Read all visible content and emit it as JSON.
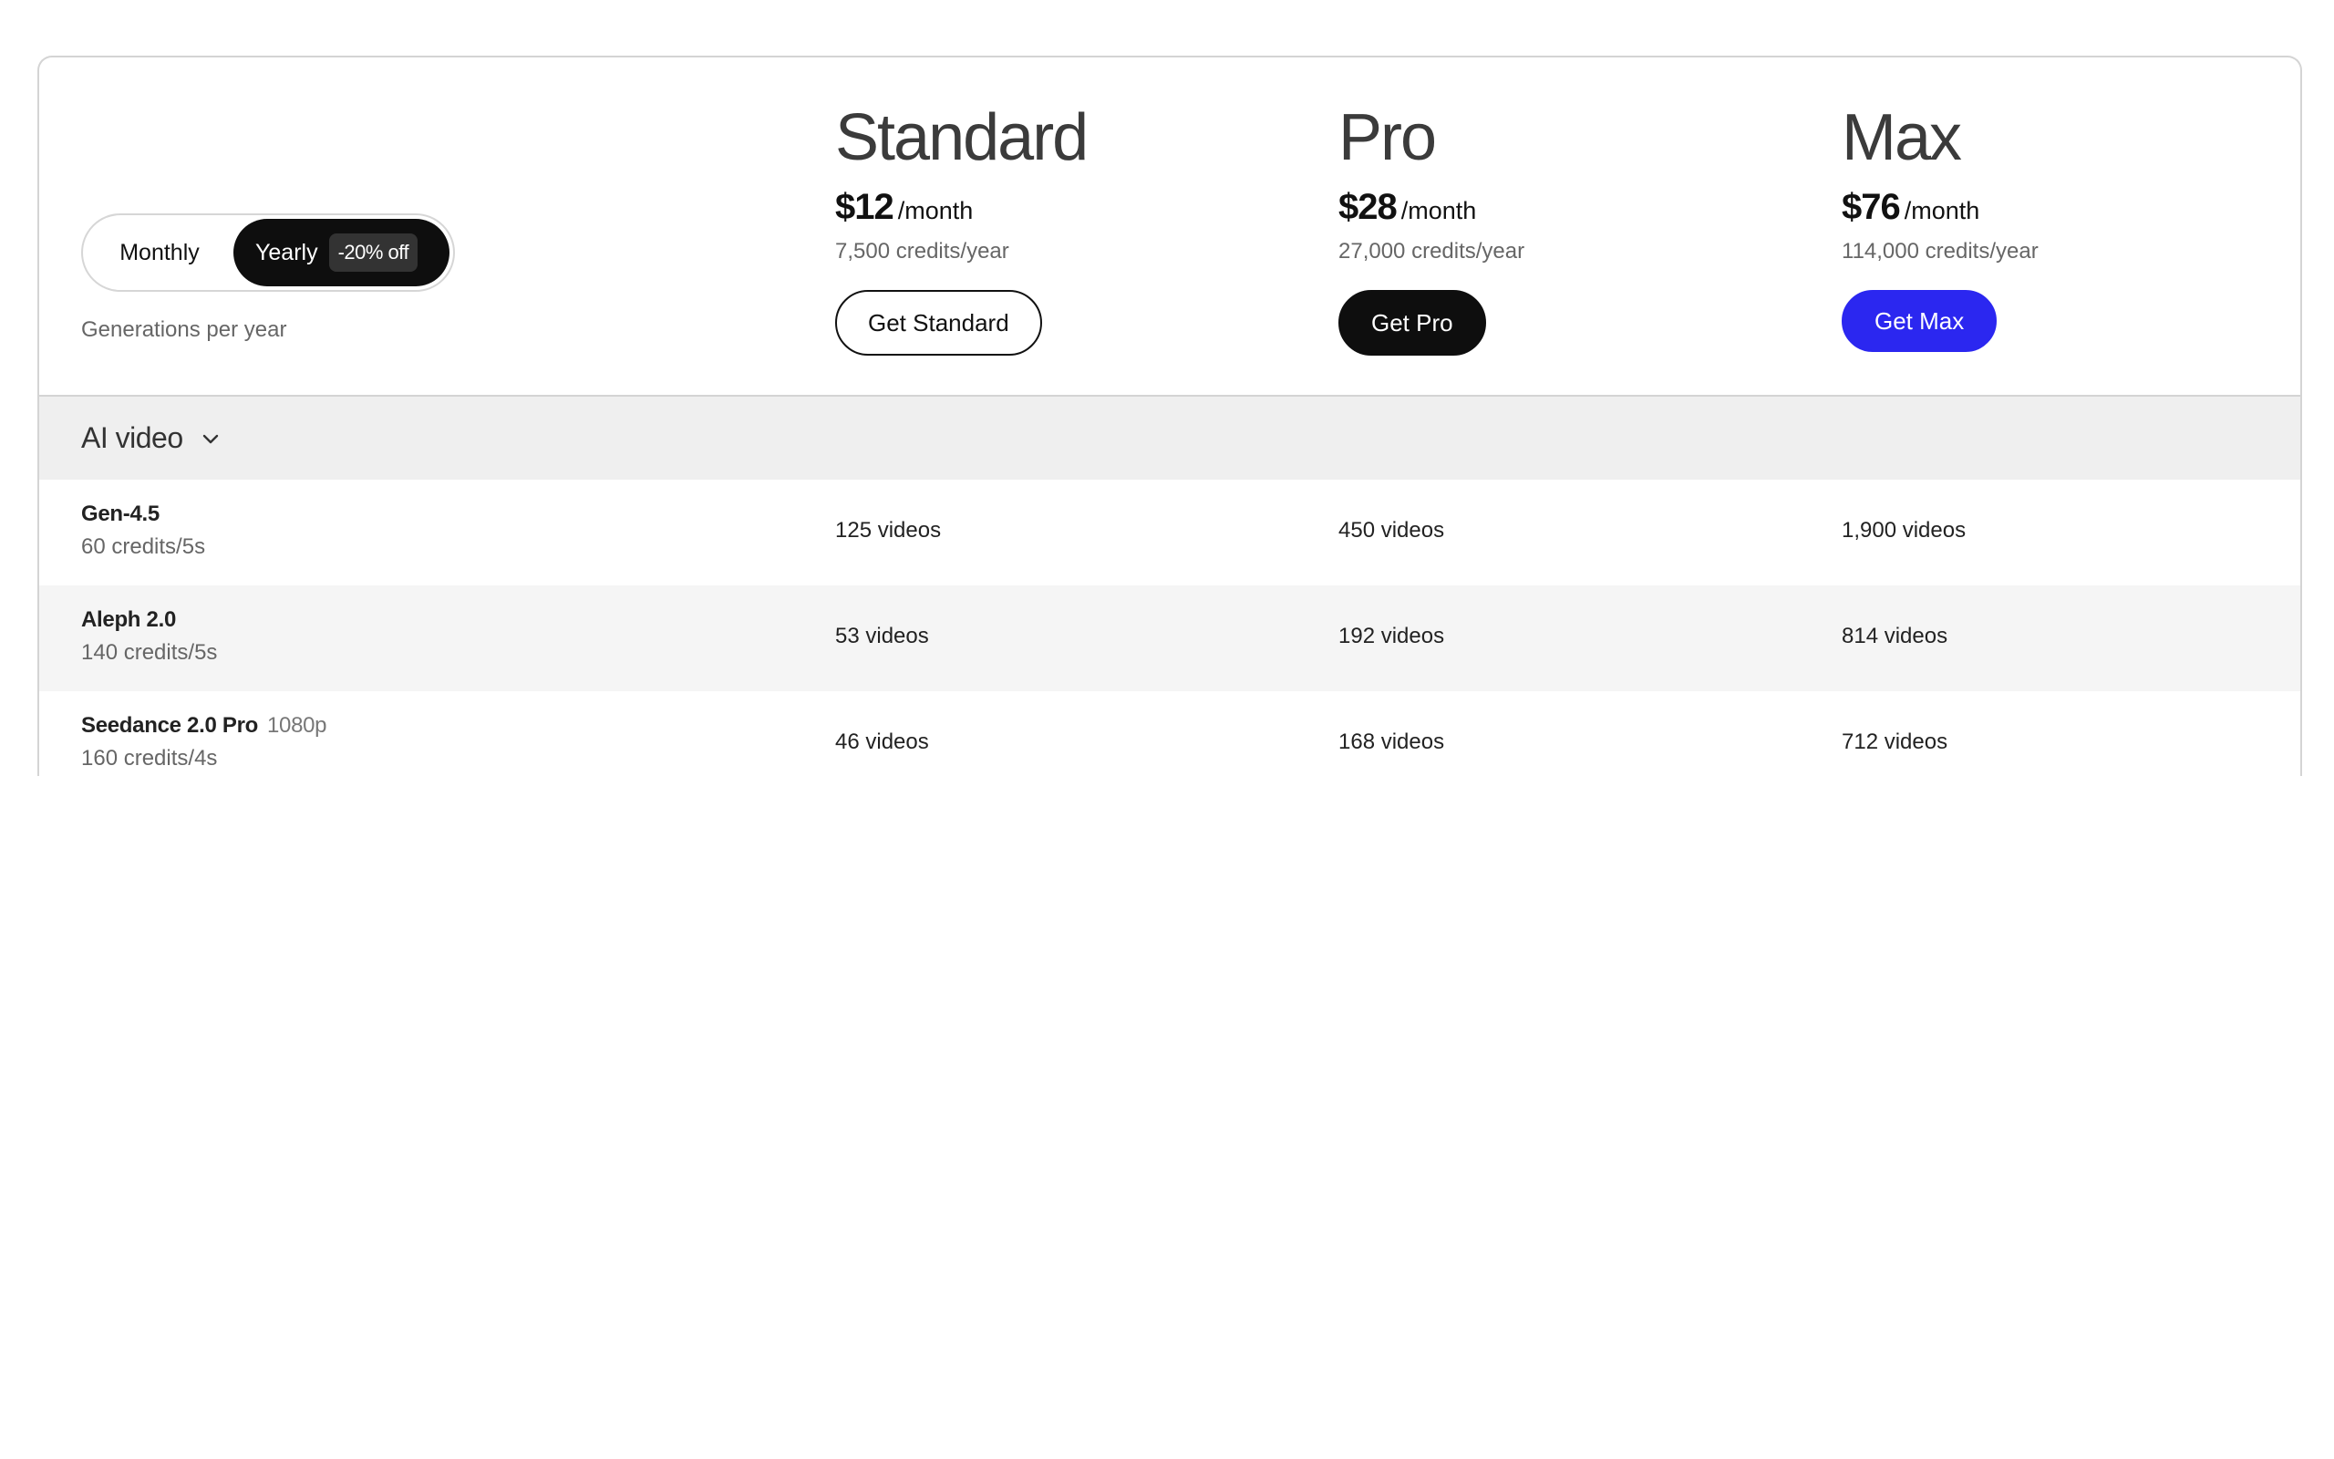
{
  "billing_toggle": {
    "monthly_label": "Monthly",
    "yearly_label": "Yearly",
    "yearly_discount": "-20% off",
    "selected": "Yearly"
  },
  "generations_label": "Generations per year",
  "plans": [
    {
      "name": "Standard",
      "price": "$12",
      "period": "/month",
      "credits": "7,500 credits/year",
      "cta": "Get Standard"
    },
    {
      "name": "Pro",
      "price": "$28",
      "period": "/month",
      "credits": "27,000 credits/year",
      "cta": "Get Pro"
    },
    {
      "name": "Max",
      "price": "$76",
      "period": "/month",
      "credits": "114,000 credits/year",
      "cta": "Get Max"
    }
  ],
  "section": {
    "title": "AI video",
    "icon": "chevron-down-icon"
  },
  "models": [
    {
      "name": "Gen-4.5",
      "tag": "",
      "cost": "60 credits/5s",
      "standard": "125 videos",
      "pro": "450 videos",
      "max": "1,900 videos"
    },
    {
      "name": "Aleph 2.0",
      "tag": "",
      "cost": "140 credits/5s",
      "standard": "53 videos",
      "pro": "192 videos",
      "max": "814 videos"
    },
    {
      "name": "Seedance 2.0 Pro",
      "tag": "1080p",
      "cost": "160 credits/4s",
      "standard": "46 videos",
      "pro": "168 videos",
      "max": "712 videos"
    }
  ],
  "colors": {
    "max_button": "#2b27f0",
    "dark_button": "#0e0e0e",
    "section_bg": "#efefef",
    "alt_row_bg": "#f5f5f5"
  }
}
